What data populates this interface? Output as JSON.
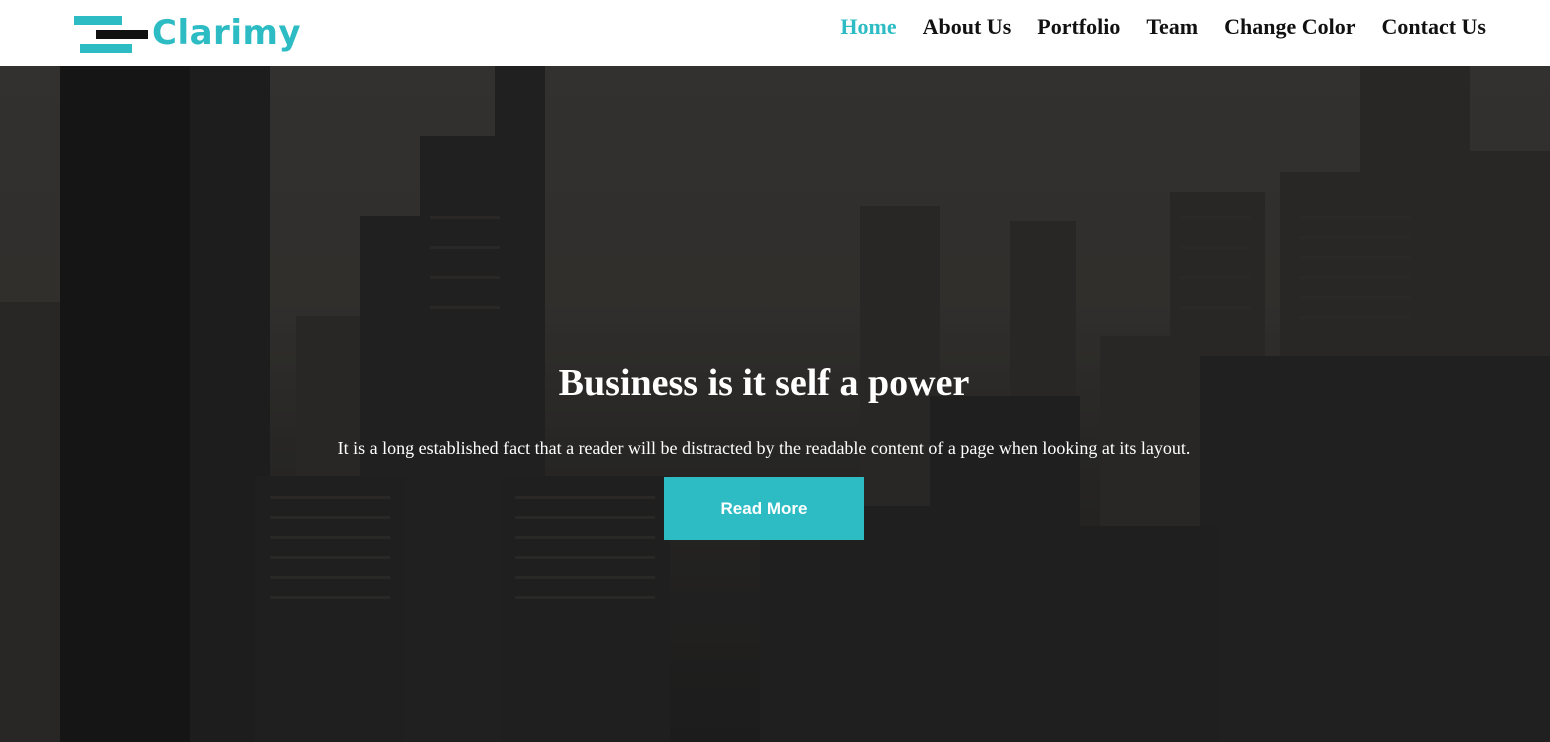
{
  "brand": {
    "name": "Clarimy"
  },
  "nav": {
    "items": [
      {
        "label": "Home",
        "active": true
      },
      {
        "label": "About Us",
        "active": false
      },
      {
        "label": "Portfolio",
        "active": false
      },
      {
        "label": "Team",
        "active": false
      },
      {
        "label": "Change Color",
        "active": false
      },
      {
        "label": "Contact Us",
        "active": false
      }
    ]
  },
  "hero": {
    "title": "Business is it self a power",
    "text": "It is a long established fact that a reader will be distracted by the readable content of a page when looking at its layout.",
    "button_label": "Read More",
    "background": "city-skyline-photo"
  },
  "colors": {
    "accent": "#2dbcc4",
    "nav_text": "#111111",
    "hero_text": "#ffffff"
  }
}
